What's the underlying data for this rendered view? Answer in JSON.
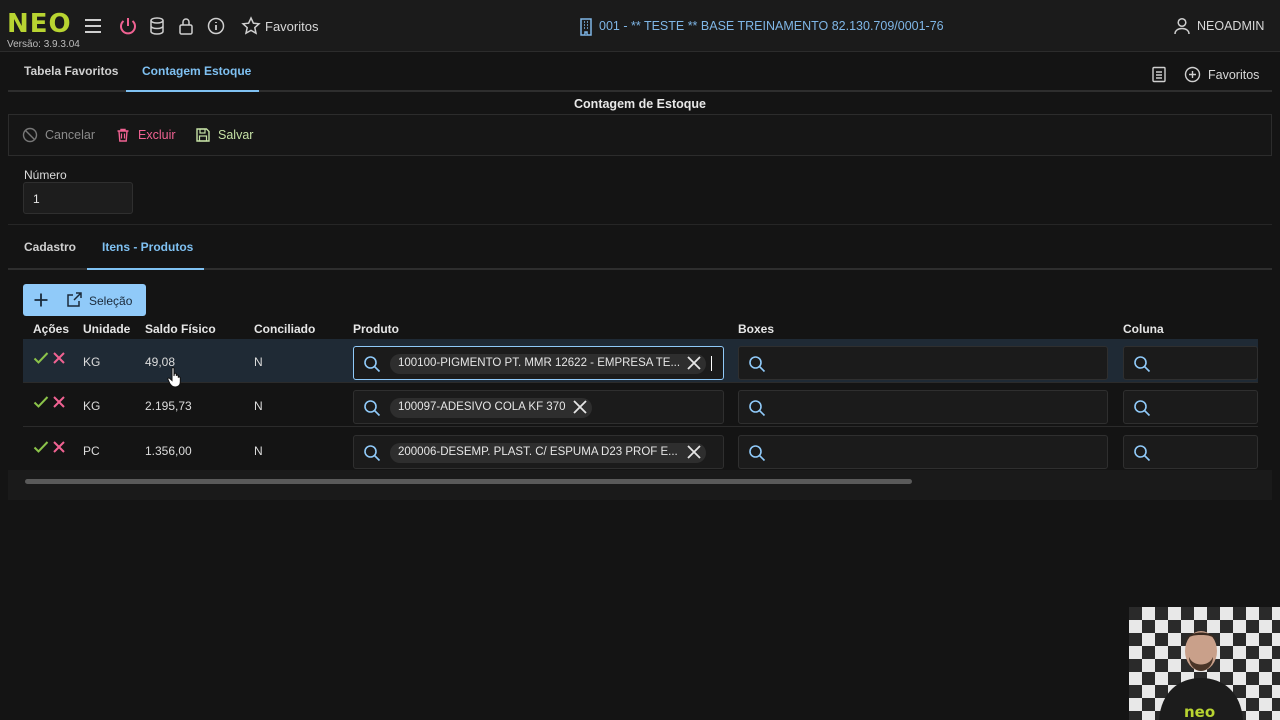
{
  "header": {
    "logo": "NEO",
    "version": "Versão: 3.9.3.04",
    "favorites_label": "Favoritos",
    "company": "001 - ** TESTE ** BASE TREINAMENTO 82.130.709/0001-76",
    "user": "NEOADMIN"
  },
  "top_tabs": [
    {
      "label": "Tabela Favoritos",
      "active": false
    },
    {
      "label": "Contagem Estoque",
      "active": true
    }
  ],
  "right_favorites": "Favoritos",
  "page_title": "Contagem de Estoque",
  "toolbar": {
    "cancel": "Cancelar",
    "delete": "Excluir",
    "save": "Salvar"
  },
  "form": {
    "numero_label": "Número",
    "numero_value": "1"
  },
  "sub_tabs": [
    {
      "label": "Cadastro",
      "active": false
    },
    {
      "label": "Itens - Produtos",
      "active": true
    }
  ],
  "selection_button": "Seleção",
  "table": {
    "headers": [
      "Ações",
      "Unidade",
      "Saldo Físico",
      "Conciliado",
      "Produto",
      "Boxes",
      "Coluna"
    ],
    "rows": [
      {
        "unidade": "KG",
        "saldo": "49,08",
        "conciliado": "N",
        "produto": "100100-PIGMENTO PT. MMR 12622 - EMPRESA TE...",
        "selected": true
      },
      {
        "unidade": "KG",
        "saldo": "2.195,73",
        "conciliado": "N",
        "produto": "100097-ADESIVO COLA KF 370",
        "selected": false
      },
      {
        "unidade": "PC",
        "saldo": "1.356,00",
        "conciliado": "N",
        "produto": "200006-DESEMP. PLAST. C/ ESPUMA D23 PROF E...",
        "selected": false
      }
    ]
  },
  "colors": {
    "accent": "#90caf9",
    "logo": "#b8d431",
    "check": "#8bc34a",
    "delete": "#f06292",
    "save": "#c5e1a5"
  },
  "webcam": {
    "shirt_logo": "neo"
  }
}
